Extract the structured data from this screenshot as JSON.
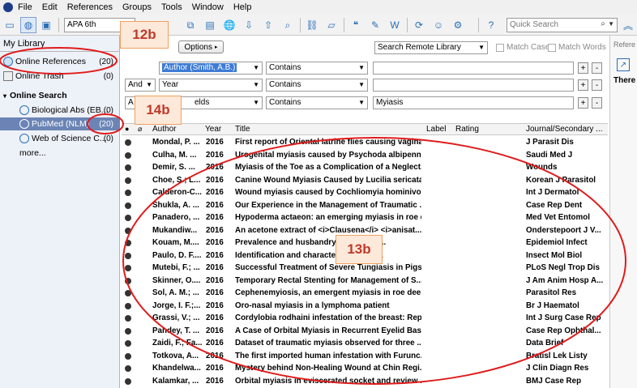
{
  "menu": [
    "File",
    "Edit",
    "References",
    "Groups",
    "Tools",
    "Window",
    "Help"
  ],
  "toolbar": {
    "style_value": "APA 6th",
    "quick_search_placeholder": "Quick Search"
  },
  "sidebar": {
    "my_library": "My Library",
    "online_references": {
      "label": "Online References",
      "count": "(20)"
    },
    "online_trash": {
      "label": "Online Trash",
      "count": "(0)"
    },
    "online_search_heading": "Online Search",
    "sources": [
      {
        "label": "Biological Abs (EB...",
        "count": "(0)"
      },
      {
        "label": "PubMed (NLM)",
        "count": "(20)"
      },
      {
        "label": "Web of Science C...",
        "count": "(0)"
      }
    ],
    "more": "more..."
  },
  "search": {
    "options_label": "Options",
    "remote_select": "Search Remote Library",
    "match_case": "Match Case",
    "match_words": "Match Words",
    "rows": [
      {
        "bool": "",
        "field": "Author (Smith, A.B.)",
        "op": "Contains",
        "value": ""
      },
      {
        "bool": "And",
        "field": "Year",
        "op": "Contains",
        "value": ""
      },
      {
        "bool": "A",
        "field": "elds",
        "op": "Contains",
        "value": "Myiasis"
      }
    ]
  },
  "right_pane": {
    "label": "Refere",
    "text": "There"
  },
  "table": {
    "headers": [
      "Author",
      "Year",
      "Title",
      "Label",
      "Rating",
      "Journal/Secondary ..."
    ],
    "rows": [
      {
        "author": "Mondal, P. ...",
        "year": "2016",
        "title": "First report of Oriental latrine flies causing vagina...",
        "journal": "J Parasit Dis"
      },
      {
        "author": "Culha, M. ...",
        "year": "2016",
        "title": "Urogenital myiasis caused by Psychoda albipennis",
        "journal": "Saudi Med J"
      },
      {
        "author": "Demir, S. ...",
        "year": "2016",
        "title": "Myiasis of the Toe as a Complication of a Neglect...",
        "journal": "Wounds"
      },
      {
        "author": "Choe, S.; L...",
        "year": "2016",
        "title": "Canine Wound Myiasis Caused by Lucilia sericata (...",
        "journal": "Korean J Parasitol"
      },
      {
        "author": "Calderon-C...",
        "year": "2016",
        "title": "Wound myiasis caused by Cochliomyia hominivora...",
        "journal": "Int J Dermatol"
      },
      {
        "author": "Shukla, A. ...",
        "year": "2016",
        "title": "Our Experience in the Management of Traumatic ...",
        "journal": "Case Rep Dent"
      },
      {
        "author": "Panadero, ...",
        "year": "2016",
        "title": "Hypoderma actaeon: an emerging myiasis in roe d...",
        "journal": "Med Vet Entomol"
      },
      {
        "author": "Mukandiw...",
        "year": "2016",
        "title": "An acetone extract of <i>Clausena</i> <i>anisat...",
        "journal": "Onderstepoort J V..."
      },
      {
        "author": "Kouam, M....",
        "year": "2016",
        "title": "Prevalence and husbandry-r...ctors of ...",
        "journal": "Epidemiol Infect"
      },
      {
        "author": "Paulo, D. F....",
        "year": "2016",
        "title": "Identification and character...roRNAs ...",
        "journal": "Insect Mol Biol"
      },
      {
        "author": "Mutebi, F.; ...",
        "year": "2016",
        "title": "Successful Treatment of Severe Tungiasis in Pigs ...",
        "journal": "PLoS Negl Trop Dis"
      },
      {
        "author": "Skinner, O....",
        "year": "2016",
        "title": "Temporary Rectal Stenting for Management of S...",
        "journal": "J Am Anim Hosp A..."
      },
      {
        "author": "Sol, A. M.; ...",
        "year": "2016",
        "title": "Cephenemyiosis, an emergent myiasis in roe deer...",
        "journal": "Parasitol Res"
      },
      {
        "author": "Jorge, I. F.;...",
        "year": "2016",
        "title": "Oro-nasal myiasis in a lymphoma patient",
        "journal": "Br J Haematol"
      },
      {
        "author": "Grassi, V.; ...",
        "year": "2016",
        "title": "Cordylobia rodhaini infestation of the breast: Rep...",
        "journal": "Int J Surg Case Rep"
      },
      {
        "author": "Pandey, T. ...",
        "year": "2016",
        "title": "A Case of Orbital Myiasis in Recurrent Eyelid Basal...",
        "journal": "Case Rep Ophthal..."
      },
      {
        "author": "Zaidi, F.; Fa...",
        "year": "2016",
        "title": "Dataset of traumatic myiasis observed for three ...",
        "journal": "Data Brief"
      },
      {
        "author": "Totkova, A...",
        "year": "2016",
        "title": "The first imported human infestation with Furunc...",
        "journal": "Bratisl Lek Listy"
      },
      {
        "author": "Khandelwa...",
        "year": "2016",
        "title": "Mystery behind Non-Healing Wound at Chin Regi...",
        "journal": "J Clin Diagn Res"
      },
      {
        "author": "Kalamkar, ...",
        "year": "2016",
        "title": "Orbital myiasis in eviscerated socket and review ...",
        "journal": "BMJ Case Rep"
      }
    ]
  },
  "annotations": {
    "a": "12b",
    "b": "14b",
    "c": "13b"
  },
  "colors": {
    "accent": "#1e73be",
    "selection": "#6b84b5",
    "annotation": "#e01b1b"
  }
}
